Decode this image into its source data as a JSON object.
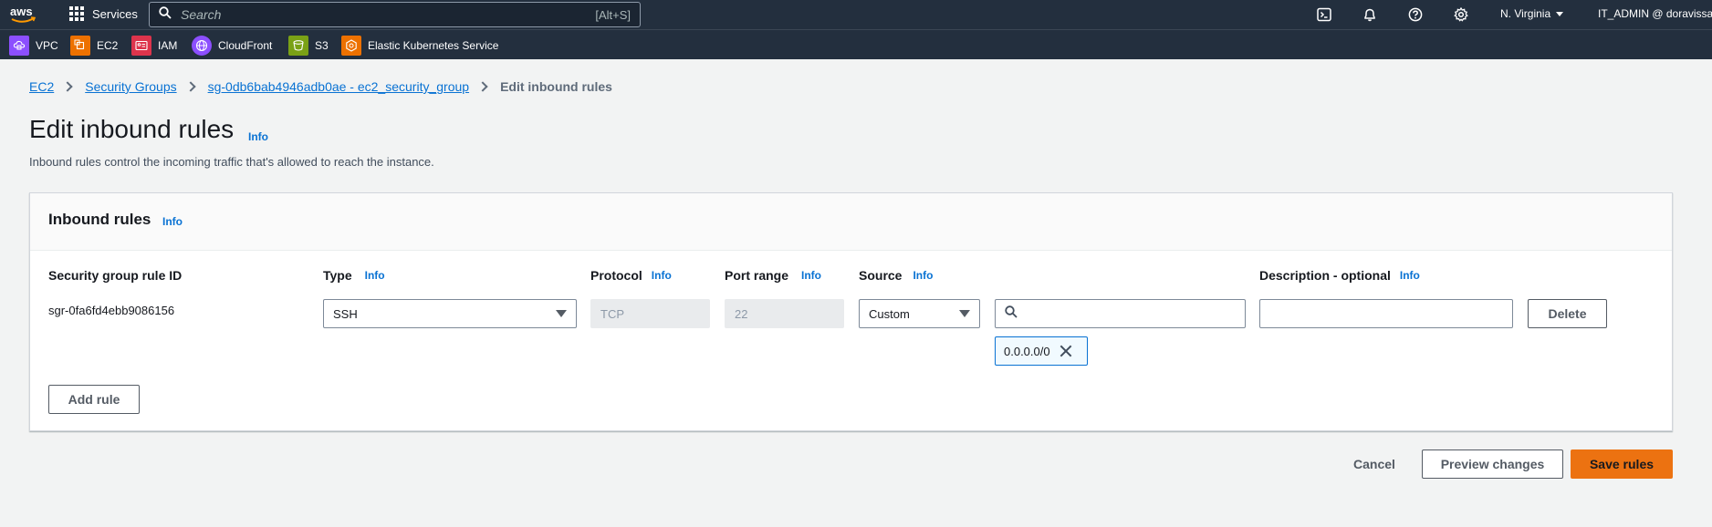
{
  "topnav": {
    "logo_text": "aws",
    "services_label": "Services",
    "search_placeholder": "Search",
    "search_shortcut": "[Alt+S]",
    "icons": [
      "cloudshell-icon",
      "bell-icon",
      "help-icon",
      "gear-icon"
    ],
    "region": "N. Virginia",
    "account": "IT_ADMIN @ doravissar"
  },
  "favorites": [
    {
      "label": "VPC",
      "color": "#8c4fff",
      "icon": "vpc-icon"
    },
    {
      "label": "EC2",
      "color": "#ed7100",
      "icon": "ec2-icon"
    },
    {
      "label": "IAM",
      "color": "#dd344c",
      "icon": "iam-icon"
    },
    {
      "label": "CloudFront",
      "color": "#8c4fff",
      "icon": "cloudfront-icon"
    },
    {
      "label": "S3",
      "color": "#7aa116",
      "icon": "s3-icon"
    },
    {
      "label": "Elastic Kubernetes Service",
      "color": "#ed7100",
      "icon": "eks-icon"
    }
  ],
  "breadcrumb": {
    "ec2": "EC2",
    "security_groups": "Security Groups",
    "sg": "sg-0db6bab4946adb0ae - ec2_security_group",
    "current": "Edit inbound rules"
  },
  "page": {
    "title": "Edit inbound rules",
    "info": "Info",
    "description": "Inbound rules control the incoming traffic that's allowed to reach the instance."
  },
  "panel": {
    "title": "Inbound rules",
    "info": "Info",
    "columns": {
      "rule_id": "Security group rule ID",
      "type": "Type",
      "protocol": "Protocol",
      "port_range": "Port range",
      "source": "Source",
      "description": "Description - optional"
    },
    "rule": {
      "id": "sgr-0fa6fd4ebb9086156",
      "type": "SSH",
      "protocol": "TCP",
      "port_range": "22",
      "source": "Custom",
      "source_search": "",
      "cidr_token": "0.0.0.0/0",
      "description": "",
      "delete_label": "Delete"
    },
    "add_rule_label": "Add rule"
  },
  "footer": {
    "cancel": "Cancel",
    "preview": "Preview changes",
    "save": "Save rules"
  },
  "colors": {
    "nav_bg": "#232f3e",
    "link": "#0972d3",
    "primary": "#ec7211"
  }
}
